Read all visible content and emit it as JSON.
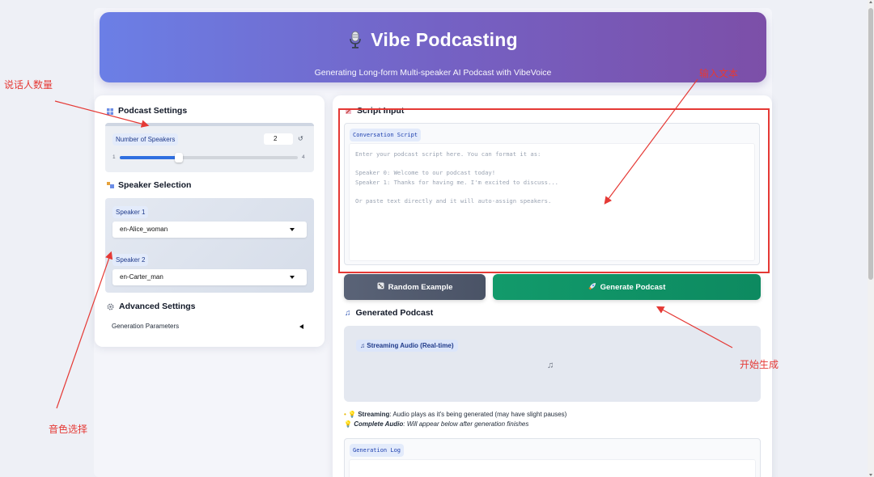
{
  "header": {
    "title": "Vibe Podcasting",
    "subtitle": "Generating Long-form Multi-speaker AI Podcast with VibeVoice",
    "icon": "microphone-icon"
  },
  "podcast_settings": {
    "title": "Podcast Settings",
    "num_speakers_label": "Number of Speakers",
    "num_speakers_value": "2",
    "slider_min": "1",
    "slider_max": "4",
    "slider_fraction": 0.33
  },
  "speaker_selection": {
    "title": "Speaker Selection",
    "speakers": [
      {
        "label": "Speaker 1",
        "value": "en-Alice_woman"
      },
      {
        "label": "Speaker 2",
        "value": "en-Carter_man"
      }
    ]
  },
  "advanced_settings": {
    "title": "Advanced Settings",
    "row_label": "Generation Parameters"
  },
  "script_input": {
    "title": "Script Input",
    "box_label": "Conversation Script",
    "placeholder": "Enter your podcast script here. You can format it as:\n\nSpeaker 0: Welcome to our podcast today!\nSpeaker 1: Thanks for having me. I'm excited to discuss...\n\nOr paste text directly and it will auto-assign speakers."
  },
  "buttons": {
    "random_example": "Random Example",
    "generate_podcast": "Generate Podcast"
  },
  "generated_podcast": {
    "title": "Generated Podcast",
    "streaming_label": "Streaming Audio (Real-time)",
    "info_streaming_bold": "Streaming",
    "info_streaming_text": ": Audio plays as it's being generated (may have slight pauses)",
    "info_complete_bold": "Complete Audio",
    "info_complete_text": ": Will appear below after generation finishes",
    "log_label": "Generation Log"
  },
  "annotations": {
    "num_speakers": "说话人数量",
    "voice_selection": "音色选择",
    "input_text": "输入文本",
    "start_generation": "开始生成"
  },
  "colors": {
    "header_gradient_start": "#6b7fe6",
    "header_gradient_end": "#7c4fa8",
    "generate_green": "#129a6b",
    "annotation_red": "#e53935"
  }
}
